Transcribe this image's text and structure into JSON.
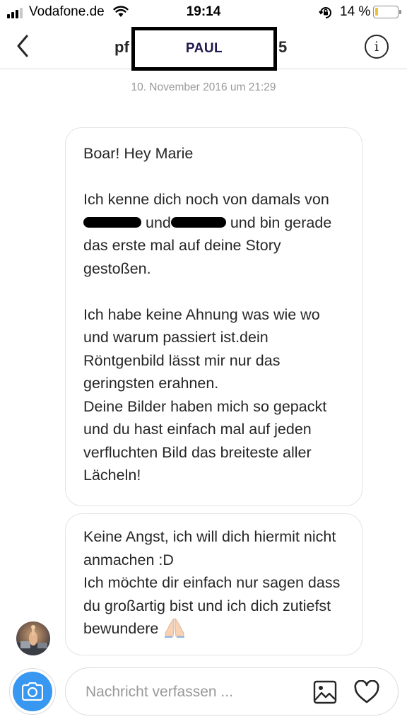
{
  "status_bar": {
    "carrier": "Vodafone.de",
    "time": "19:14",
    "battery_percent": "14 %",
    "battery_level": 0.14
  },
  "header": {
    "username_left": "pf",
    "username_right": "5",
    "name_overlay": "PAUL"
  },
  "thread": {
    "timestamp": "10. November 2016 um 21:29",
    "message1": {
      "greeting": "Boar! Hey Marie",
      "para2_start": "Ich kenne dich noch von damals von",
      "para2_and": "und",
      "para2_rest": "und bin gerade das erste mal auf deine Story gestoßen.",
      "para3a": "Ich habe keine Ahnung was wie wo und warum passiert ist.dein Röntgenbild lässt mir nur das geringsten erahnen.",
      "para3b": "Deine Bilder haben mich so gepackt und du hast einfach mal auf jeden verfluchten Bild das breiteste aller Lächeln!"
    },
    "message2": {
      "line1": "Keine Angst, ich will dich hiermit nicht anmachen :D",
      "line2": "Ich möchte dir einfach nur sagen dass du großartig bist und ich dich zutiefst bewundere"
    }
  },
  "composer": {
    "placeholder": "Nachricht verfassen ..."
  },
  "icons": {
    "back": "chevron-left-icon",
    "info": "info-icon",
    "camera": "camera-icon",
    "gallery": "image-icon",
    "heart": "heart-icon",
    "emoji": "folded-hands-emoji"
  },
  "colors": {
    "accent_blue": "#3897f0",
    "bubble_border": "#e3e3e3",
    "timestamp_gray": "#999999",
    "battery_yellow": "#f2c12e"
  }
}
